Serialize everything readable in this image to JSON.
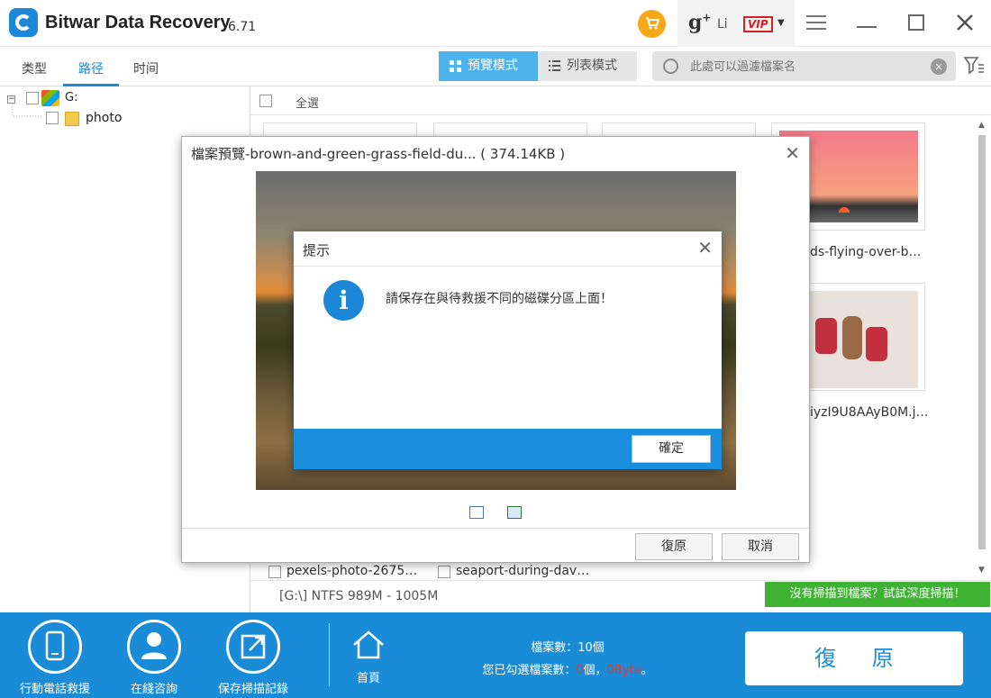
{
  "app": {
    "title": "Bitwar Data Recovery",
    "version": "6.71"
  },
  "header": {
    "user_name": "Li",
    "vip_label": "VIP",
    "gplus": "g",
    "gplus_sup": "+"
  },
  "tabs": [
    {
      "label": "类型"
    },
    {
      "label": "路径"
    },
    {
      "label": "时间"
    }
  ],
  "view_modes": {
    "preview": "預覽模式",
    "list": "列表模式"
  },
  "search": {
    "placeholder": "此處可以過濾檔案名"
  },
  "tree": {
    "drive": "G:",
    "folder": "photo"
  },
  "content": {
    "select_all": "全選",
    "visible_file_names": [
      "ds-flying-over-b…",
      "iyzI9U8AAyB0M.j…",
      "pexels-photo-2675…",
      "seaport-during-dav…"
    ],
    "drive_info": "[G:\\] NTFS 989M - 1005M",
    "deep_scan": "沒有掃描到檔案？試試深度掃描！"
  },
  "preview_dialog": {
    "title": "檔案預覽-brown-and-green-grass-field-du... ( 374.14KB )",
    "recover_button": "復原",
    "cancel_button": "取消"
  },
  "alert_dialog": {
    "title": "提示",
    "message": "請保存在與待救援不同的磁碟分區上面！",
    "ok_button": "確定"
  },
  "bottom": {
    "items": [
      {
        "label": "行動電話救援"
      },
      {
        "label": "在綫咨詢"
      },
      {
        "label": "保存掃描記錄"
      },
      {
        "label": "首頁"
      }
    ],
    "file_count_label": "檔案數：10個",
    "selected_prefix": "您已勾選檔案數：",
    "selected_count": "0",
    "selected_unit": "個",
    "selected_sep": "，",
    "selected_size": "0Byte",
    "selected_suffix": "。",
    "recover_button": "復 原"
  },
  "colors": {
    "accent": "#1a8bd6",
    "deep_scan": "#3fb234",
    "cart": "#f7a818",
    "vip": "#d32020"
  }
}
